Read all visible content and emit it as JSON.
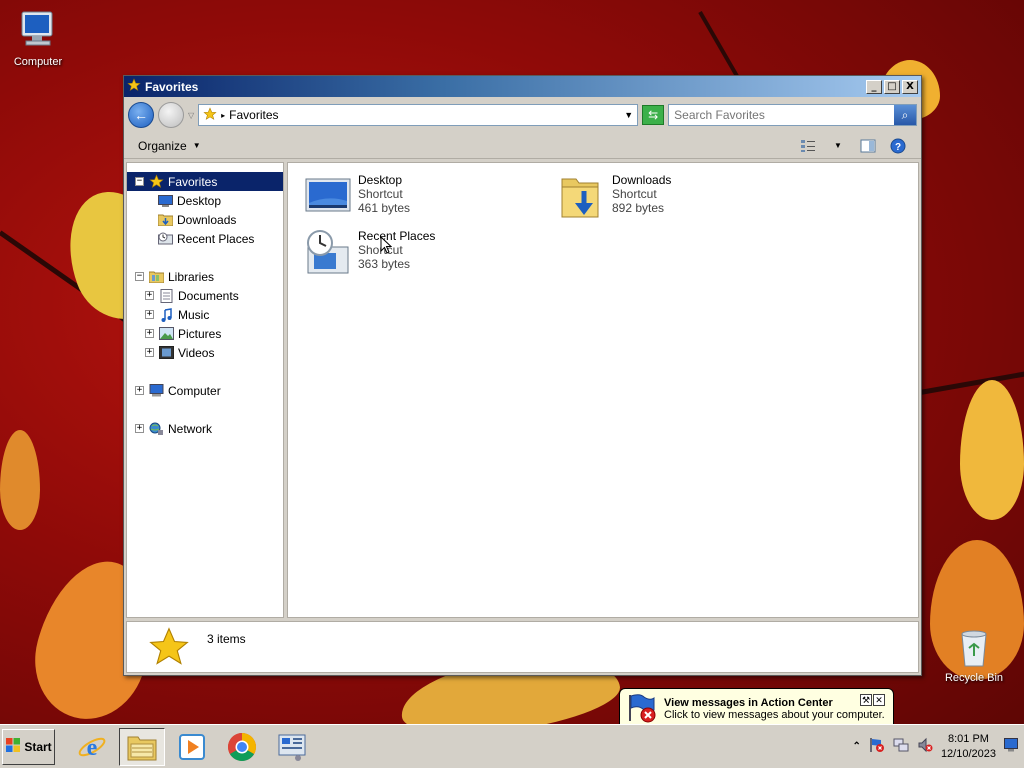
{
  "desktop": {
    "icons": [
      {
        "label": "Computer",
        "icon": "computer-icon"
      },
      {
        "label": "Recycle Bin",
        "icon": "recycle-bin-icon"
      }
    ]
  },
  "window": {
    "title": "Favorites",
    "min_label": "_",
    "max_label": "□",
    "close_label": "X"
  },
  "address": {
    "path": "Favorites",
    "search_placeholder": "Search Favorites"
  },
  "toolbar": {
    "organize_label": "Organize"
  },
  "navpane": {
    "favorites": {
      "label": "Favorites",
      "children": [
        "Desktop",
        "Downloads",
        "Recent Places"
      ]
    },
    "libraries": {
      "label": "Libraries",
      "children": [
        "Documents",
        "Music",
        "Pictures",
        "Videos"
      ]
    },
    "computer": "Computer",
    "network": "Network"
  },
  "items": [
    {
      "name": "Desktop",
      "type": "Shortcut",
      "size": "461 bytes"
    },
    {
      "name": "Downloads",
      "type": "Shortcut",
      "size": "892 bytes"
    },
    {
      "name": "Recent Places",
      "type": "Shortcut",
      "size": "363 bytes"
    }
  ],
  "details": {
    "count": "3 items"
  },
  "taskbar": {
    "start_label": "Start",
    "time": "8:01 PM",
    "date": "12/10/2023"
  },
  "balloon": {
    "title": "View messages in Action Center",
    "text": "Click to view messages about your computer."
  },
  "colors": {
    "title_bar": "#0a246a",
    "selection": "#0a246a",
    "face": "#d4d0c8",
    "balloon": "#ffffe1"
  }
}
